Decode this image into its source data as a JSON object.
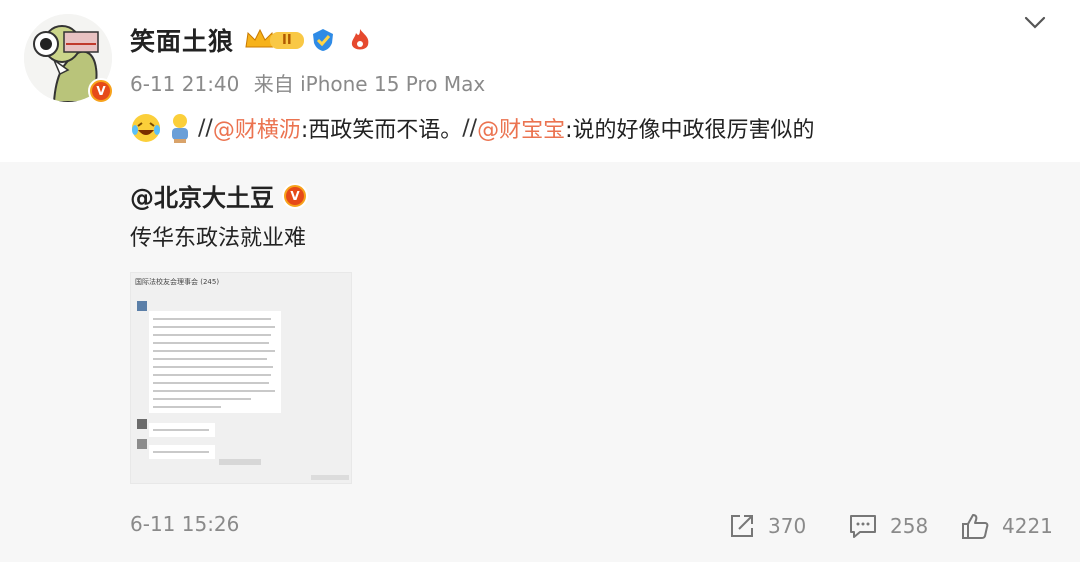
{
  "post": {
    "username": "笑面土狼",
    "vip_level": "II",
    "meta_date": "6-11 21:40",
    "meta_source": "来自 iPhone 15 Pro Max",
    "content": {
      "emoji": [
        "laugh-cry-emoji",
        "person-emoji"
      ],
      "sep1": "//",
      "mention1": "@财横沥",
      "text1": ":西政笑而不语。",
      "sep2": "//",
      "mention2": "@财宝宝",
      "text2": ":说的好像中政很厉害似的"
    }
  },
  "repost": {
    "username": "@北京大土豆",
    "text": "传华东政法就业难",
    "thumbnail_title": "国际法校友会理事会 (245)",
    "time": "6-11 15:26",
    "shares": "370",
    "comments": "258",
    "likes": "4221"
  },
  "colors": {
    "mention": "#eb7350",
    "meta": "#8a8a8a",
    "repost_bg": "#f7f7f7",
    "verified_badge": "#f7a21b"
  }
}
